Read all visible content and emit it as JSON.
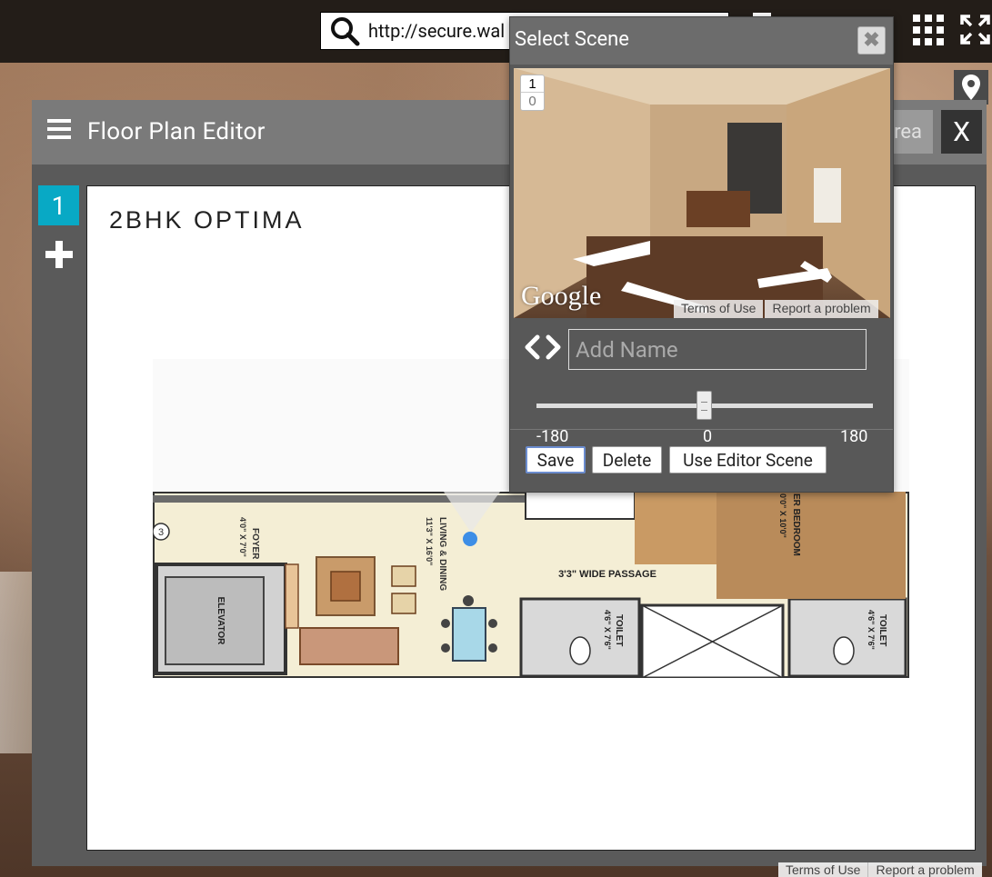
{
  "topbar": {
    "url": "http://secure.wal",
    "icons": [
      "search-icon",
      "apps-grid-icon",
      "fullscreen-icon",
      "map-pin-icon"
    ]
  },
  "editor": {
    "title": "Floor Plan Editor",
    "area_button": "rea",
    "close_label": "X",
    "floor_tab": "1",
    "plan_title": "2BHK OPTIMA",
    "plan_labels": {
      "foyer": "FOYER",
      "foyer_dim": "4'0\" X 7'0\"",
      "elevator": "ELEVATOR",
      "living": "LIVING & DINING",
      "living_dim": "11'3\" X 16'0\"",
      "passage": "3'3\" WIDE PASSAGE",
      "toilet1": "TOILET",
      "toilet1_dim": "4'6\" X 7'6\"",
      "toilet2": "TOILET",
      "toilet2_dim": "4'6\" X 7'6\"",
      "bedroom": "ER BEDROOM",
      "bedroom_dim": "0'0\" X 10'0\"",
      "marker": "3"
    }
  },
  "scene": {
    "title": "Select Scene",
    "close_symbol": "✖",
    "level_top": "1",
    "level_bottom": "0",
    "google": "Google",
    "terms": "Terms of Use",
    "report": "Report a problem",
    "name_placeholder": "Add Name",
    "slider": {
      "min": "-180",
      "mid": "0",
      "max": "180",
      "value": 0
    },
    "buttons": {
      "save": "Save",
      "delete": "Delete",
      "use_editor": "Use Editor Scene"
    }
  },
  "footer": {
    "terms": "Terms of Use",
    "report": "Report a problem"
  },
  "colors": {
    "accent": "#08a9c5",
    "marker": "#3d8ee6",
    "topbar": "#231d18"
  }
}
